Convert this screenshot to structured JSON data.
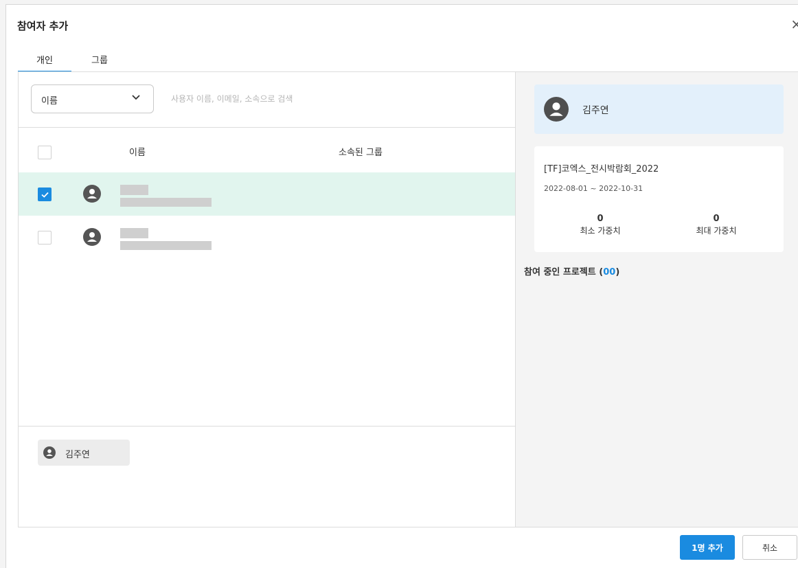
{
  "dialog": {
    "title": "참여자 추가",
    "close_glyph": "×",
    "tabs": [
      {
        "label": "개인",
        "active": true
      },
      {
        "label": "그룹",
        "active": false
      }
    ]
  },
  "search": {
    "field_selected": "이름",
    "placeholder": "사용자 이름, 이메일, 소속으로 검색"
  },
  "table": {
    "columns": [
      "이름",
      "소속된 그룹"
    ],
    "rows": [
      {
        "checked": true,
        "icon": "user-avatar-icon",
        "name_redacted": true
      },
      {
        "checked": false,
        "icon": "user-avatar-icon",
        "name_redacted": true
      }
    ]
  },
  "selected_chips": [
    {
      "name": "김주연",
      "icon": "user-avatar-icon"
    }
  ],
  "detail": {
    "user_name": "김주연",
    "project_name": "[TF]코엑스_전시박람회_2022",
    "project_period": "2022-08-01 ~ 2022-10-31",
    "min_weight": {
      "value": "0",
      "label": "최소 가중치"
    },
    "max_weight": {
      "value": "0",
      "label": "최대 가중치"
    },
    "participating_label": "참여 중인 프로젝트",
    "participating_open": "(",
    "participating_count": "00",
    "participating_close": ")"
  },
  "footer": {
    "add_label": "1명 추가",
    "cancel_label": "취소"
  },
  "colors": {
    "accent": "#1a8be0",
    "selected_row": "#e1f5ee",
    "user_card": "#e3f0fb"
  }
}
